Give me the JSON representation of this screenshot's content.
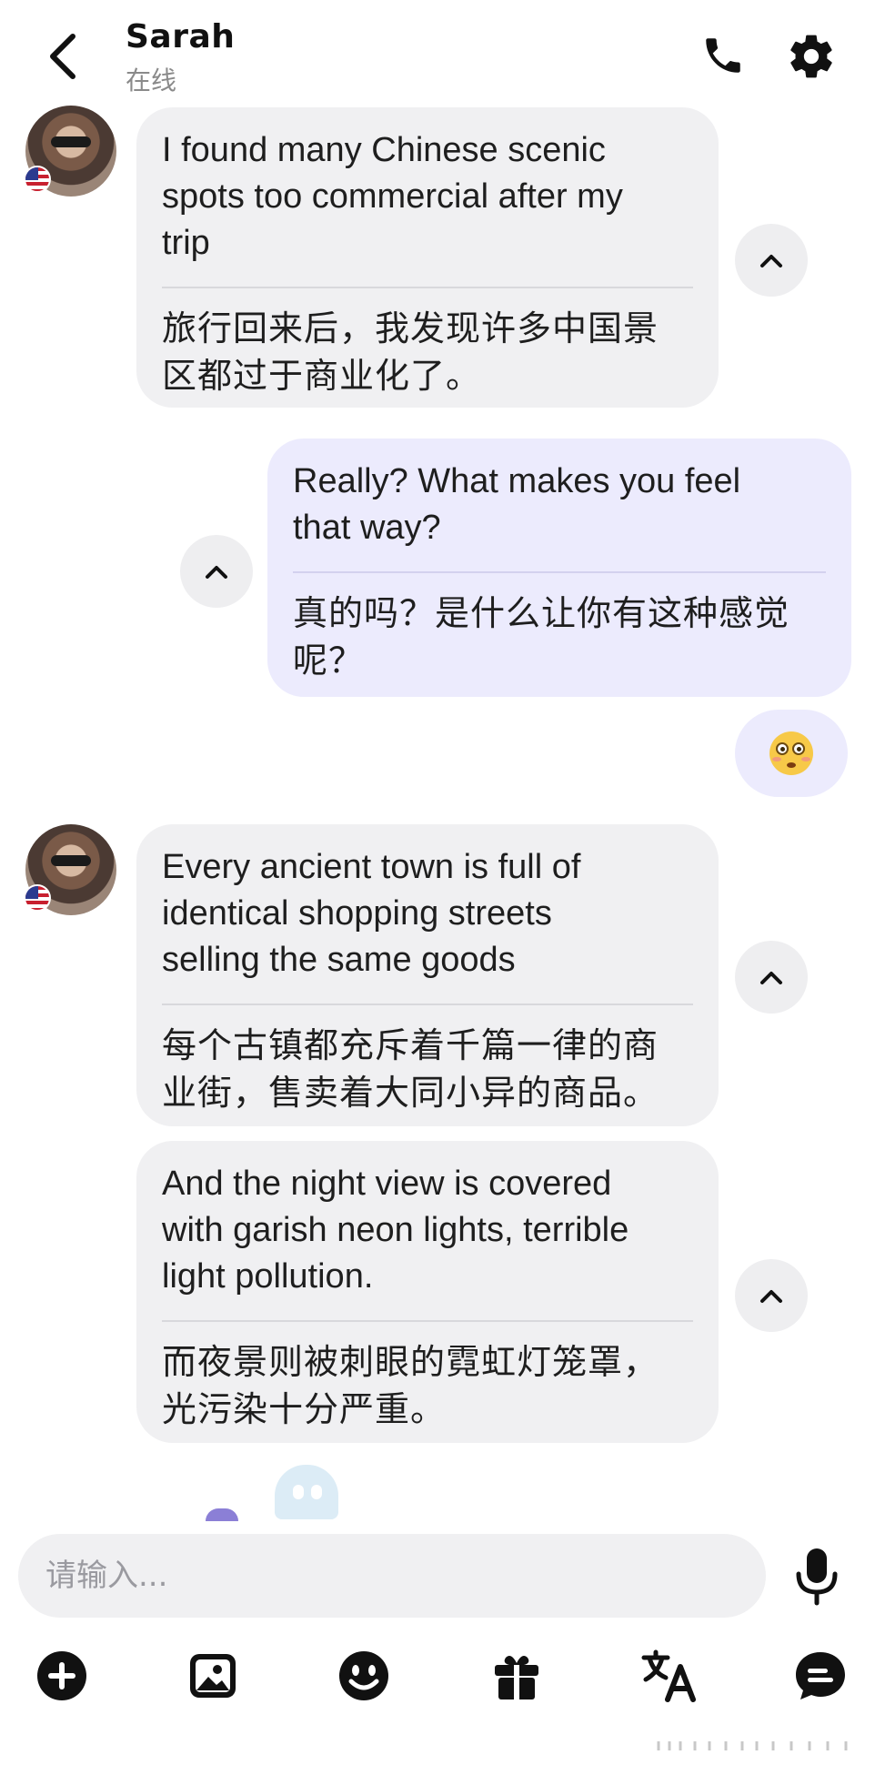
{
  "header": {
    "name": "Sarah",
    "status": "在线"
  },
  "messages": [
    {
      "side": "in",
      "en_words": [
        "I",
        "found",
        "many",
        "Chinese",
        "scenic",
        "spots",
        "too",
        "commercial",
        "after",
        "my",
        "trip"
      ],
      "en_lines": [
        "I found many Chinese scenic",
        "spots too commercial after my",
        "trip"
      ],
      "zh_lines": [
        "旅行回来后，我发现许多中国景",
        "区都过于商业化了。"
      ]
    },
    {
      "side": "out",
      "en_lines": [
        "Really? What makes you feel",
        "that way?"
      ],
      "zh_lines": [
        "真的吗？是什么让你有这种感觉",
        "呢？"
      ]
    },
    {
      "side": "in",
      "en_lines": [
        "Every ancient town is full of",
        "identical shopping streets",
        "selling the same goods"
      ],
      "zh_lines": [
        "每个古镇都充斥着千篇一律的商",
        "业街，售卖着大同小异的商品。"
      ]
    },
    {
      "side": "in",
      "en_lines": [
        "And the night view is covered",
        "with garish neon lights, terrible",
        "light pollution."
      ],
      "zh_lines": [
        "而夜景则被刺眼的霓虹灯笼罩，",
        "光污染十分严重。"
      ]
    }
  ],
  "emoji": "flushed-face",
  "input": {
    "placeholder": "请输入...",
    "value": ""
  },
  "toolbar": {
    "icons": [
      "plus-icon",
      "image-icon",
      "emoji-icon",
      "gift-icon",
      "translate-icon",
      "chat-icon"
    ]
  },
  "colors": {
    "incoming_bubble": "#f0f0f2",
    "outgoing_bubble": "#ecebfd",
    "text": "#1e1e1e",
    "muted": "#8a8a8a"
  }
}
